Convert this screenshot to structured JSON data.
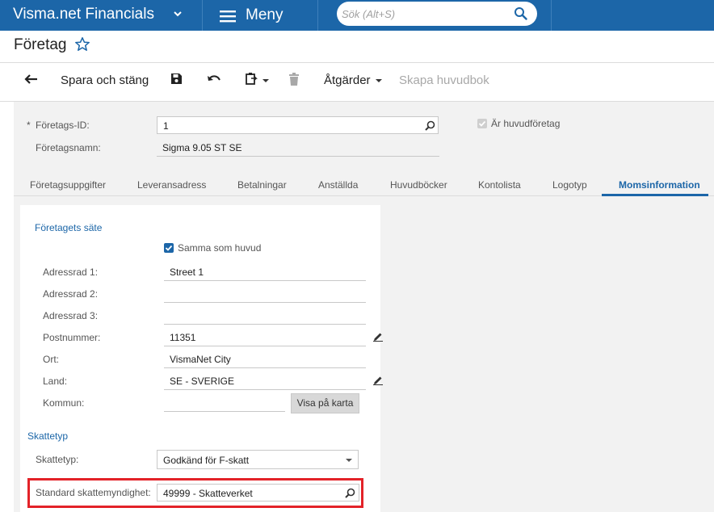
{
  "app": {
    "title": "Visma.net Financials",
    "menu_label": "Meny"
  },
  "search": {
    "placeholder": "Sök (Alt+S)"
  },
  "page": {
    "title": "Företag"
  },
  "toolbar": {
    "save_close_label": "Spara och stäng",
    "actions_label": "Åtgärder",
    "create_ledger_label": "Skapa huvudbok"
  },
  "header": {
    "company_id_label": "Företags-ID:",
    "company_id_value": "1",
    "company_name_label": "Företagsnamn:",
    "company_name_value": "Sigma 9.05 ST SE",
    "is_main_company_label": "Är huvudföretag"
  },
  "tabs": [
    {
      "label": "Företagsuppgifter"
    },
    {
      "label": "Leveransadress"
    },
    {
      "label": "Betalningar"
    },
    {
      "label": "Anställda"
    },
    {
      "label": "Huvudböcker"
    },
    {
      "label": "Kontolista"
    },
    {
      "label": "Logotyp"
    },
    {
      "label": "Momsinformation"
    }
  ],
  "active_tab": "Momsinformation",
  "seat": {
    "section_title": "Företagets säte",
    "same_as_main_label": "Samma som huvud",
    "address1_label": "Adressrad 1:",
    "address1_value": "Street 1",
    "address2_label": "Adressrad 2:",
    "address2_value": "",
    "address3_label": "Adressrad 3:",
    "address3_value": "",
    "postcode_label": "Postnummer:",
    "postcode_value": "11351",
    "city_label": "Ort:",
    "city_value": "VismaNet City",
    "country_label": "Land:",
    "country_value": "SE - SVERIGE",
    "municipality_label": "Kommun:",
    "municipality_value": "",
    "map_button_label": "Visa på karta"
  },
  "tax": {
    "section_title": "Skattetyp",
    "tax_type_label": "Skattetyp:",
    "tax_type_value": "Godkänd för F-skatt",
    "authority_label": "Standard skattemyndighet:",
    "authority_value": "49999 - Skatteverket"
  },
  "colors": {
    "brand": "#1c66a8",
    "highlight": "#e32228"
  }
}
